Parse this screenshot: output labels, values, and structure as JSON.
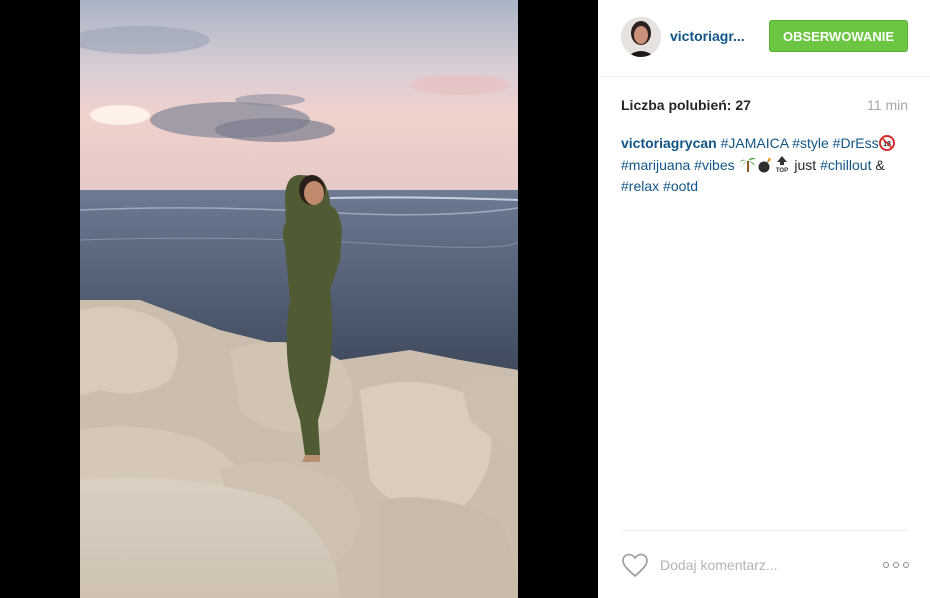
{
  "header": {
    "username": "victoriagr...",
    "follow_label": "OBSERWOWANIE"
  },
  "stats": {
    "likes": "Liczba polubień: 27",
    "time": "11 min"
  },
  "caption": {
    "username": "victoriagrycan",
    "tag_jamaica": "#JAMAICA",
    "tag_style": "#style",
    "tag_dress": "#DrEss",
    "tag_marijuana": "#marijuana",
    "tag_vibes": "#vibes",
    "text_just": "just",
    "tag_chillout": "#chillout",
    "text_amp": "&",
    "tag_relax": "#relax",
    "tag_ootd": "#ootd"
  },
  "comment": {
    "placeholder": "Dodaj komentarz..."
  },
  "colors": {
    "link": "#125688",
    "follow_button": "#6cc644",
    "muted": "#a5a7aa"
  },
  "icons": [
    "heart-icon",
    "more-options-icon",
    "palm-tree-emoji",
    "bomb-emoji",
    "top-arrow-emoji",
    "eighteen-emoji"
  ]
}
